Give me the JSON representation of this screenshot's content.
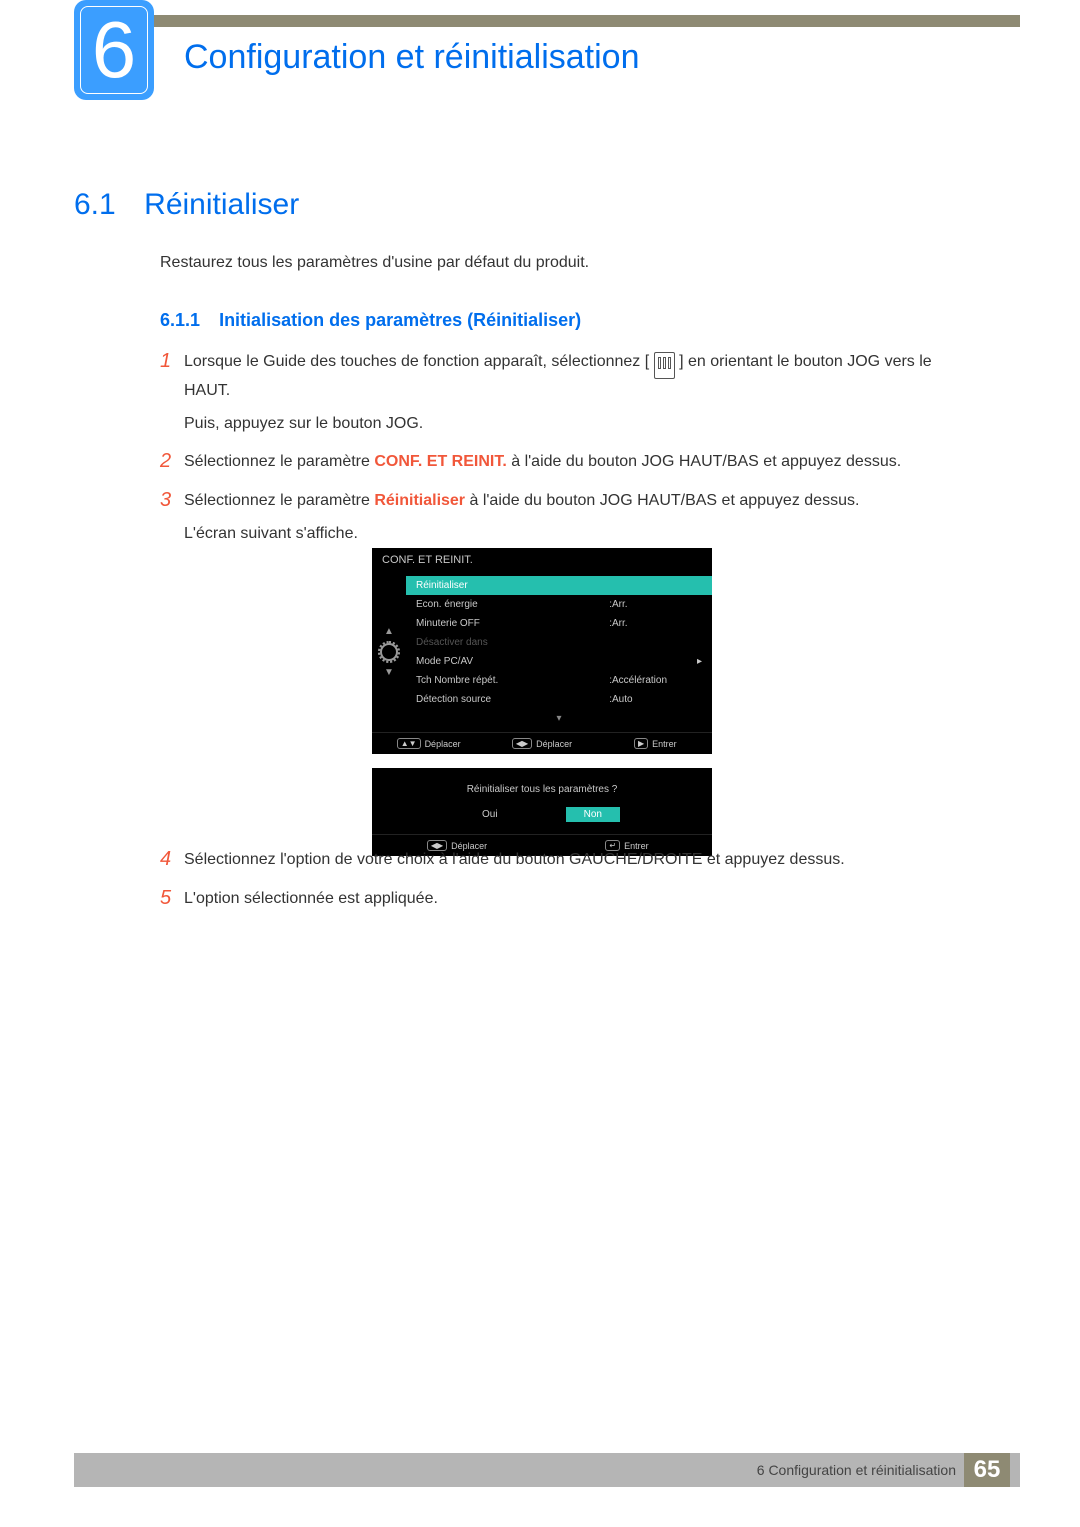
{
  "chapter": {
    "number": "6",
    "title": "Configuration et réinitialisation"
  },
  "section": {
    "number": "6.1",
    "title": "Réinitialiser"
  },
  "intro": "Restaurez tous les paramètres d'usine par défaut du produit.",
  "subsection": {
    "number": "6.1.1",
    "title": "Initialisation des paramètres (Réinitialiser)"
  },
  "steps": {
    "s1a": "Lorsque le Guide des touches de fonction apparaît, sélectionnez [",
    "s1b": "] en orientant le bouton JOG vers le HAUT.",
    "s1c": "Puis, appuyez sur le bouton JOG.",
    "s2a": "Sélectionnez le paramètre ",
    "s2b": "CONF. ET REINIT.",
    "s2c": " à l'aide du bouton JOG HAUT/BAS et appuyez dessus.",
    "s3a": "Sélectionnez le paramètre ",
    "s3b": "Réinitialiser",
    "s3c": " à l'aide du bouton JOG HAUT/BAS et appuyez dessus.",
    "s3d": "L'écran suivant s'affiche.",
    "s4": "Sélectionnez l'option de votre choix à l'aide du bouton GAUCHE/DROITE et appuyez dessus.",
    "s5": "L'option sélectionnée est appliquée."
  },
  "osd": {
    "title": "CONF. ET REINIT.",
    "rows": [
      {
        "label": "Réinitialiser",
        "value": "",
        "sel": true
      },
      {
        "label": "Econ. énergie",
        "value": "Arr."
      },
      {
        "label": "Minuterie OFF",
        "value": "Arr."
      },
      {
        "label": "Désactiver dans",
        "value": "",
        "dim": true
      },
      {
        "label": "Mode PC/AV",
        "value": "",
        "tri": true
      },
      {
        "label": "Tch Nombre répét.",
        "value": "Accélération"
      },
      {
        "label": "Détection source",
        "value": "Auto"
      }
    ],
    "foot": {
      "move": "Déplacer",
      "enter": "Entrer"
    }
  },
  "dialog": {
    "question": "Réinitialiser tous les paramètres ?",
    "yes": "Oui",
    "no": "Non",
    "move": "Déplacer",
    "enter": "Entrer"
  },
  "footer": {
    "label": "6 Configuration et réinitialisation",
    "page": "65"
  }
}
